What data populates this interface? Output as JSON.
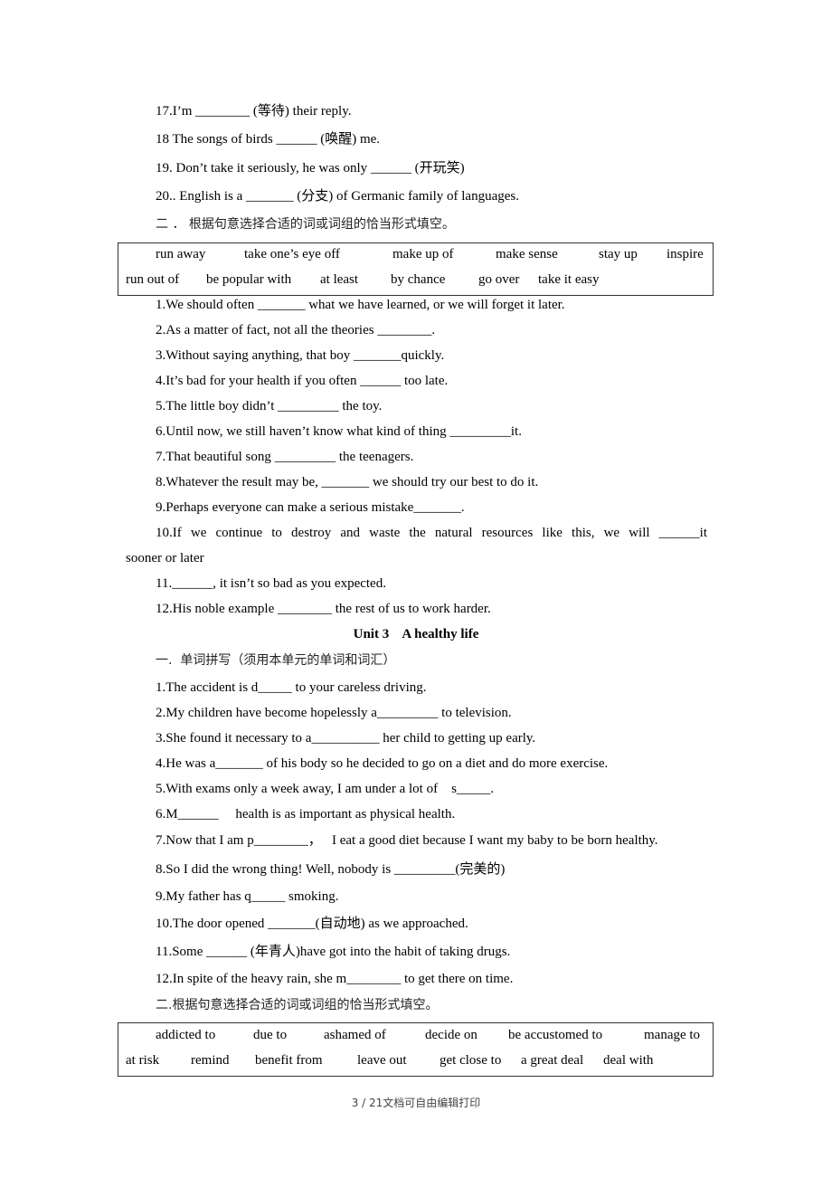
{
  "section_a_items": [
    {
      "number": "17.",
      "text": "I’m ________ (等待) their reply."
    },
    {
      "number": "18",
      "text": " The songs of birds ______ (唤醒) me."
    },
    {
      "number": "19.",
      "text": " Don’t take it seriously, he was only ______ (开玩笑)"
    },
    {
      "number": "20..",
      "text": " English is a _______ (分支) of Germanic family of languages."
    }
  ],
  "section_b": {
    "instruction": "二 ． 根据句意选择合适的词或词组的恰当形式填空。",
    "word_bank": {
      "row1": [
        "run away",
        "take one’s eye off",
        "make up of",
        "make sense",
        "stay up",
        "inspire"
      ],
      "row2": [
        "run out of",
        "be popular with",
        "at least",
        "by chance",
        "go over",
        "take it easy"
      ]
    },
    "items": [
      "1.We should often _______ what we have learned, or we will forget it later.",
      "2.As a matter of fact, not all the theories ________.",
      "3.Without saying anything, that boy _______quickly.",
      "4.It’s bad for your health if you often ______ too late.",
      "5.The little boy didn’t _________ the toy.",
      "6.Until now, we still haven’t know what kind of thing _________it.",
      "7.That beautiful song _________ the teenagers.",
      "8.Whatever the result may be, _______ we should try our best to do it.",
      "9.Perhaps everyone can make a serious mistake_______.",
      "10.If we continue to destroy and waste the natural resources like this, we will ______it",
      "sooner or later",
      "11.______, it isn’t so bad as you expected.",
      "12.His noble example ________ the rest of us to work harder."
    ]
  },
  "unit3": {
    "title": "Unit 3    A healthy life",
    "section_a_instruction": "一.  单词拼写（须用本单元的单词和词汇）",
    "section_a_items": [
      "1.The accident is d_____ to your careless driving.",
      "2.My children have become hopelessly a_________ to television.",
      "3.She found it necessary to a__________ her child to getting up early.",
      "4.He was a_______ of his body so he decided to go on a diet and do more exercise.",
      "5.With exams only a week away, I am under a lot of    s_____.",
      "6.M______     health is as important as physical health.",
      "7.Now that I am p________，   I eat a good diet because I want my baby to be born healthy.",
      "8.So I did the wrong thing! Well, nobody is _________(完美的)",
      "9.My father has q_____ smoking.",
      "10.The door opened _______(自动地) as we approached.",
      "11.Some ______ (年青人)have got into the habit of taking drugs.",
      "12.In spite of the heavy rain, she m________ to get there on time."
    ],
    "section_b_instruction": "二.根据句意选择合适的词或词组的恰当形式填空。",
    "word_bank": {
      "row1": [
        "addicted to",
        "due to",
        "ashamed of",
        "decide on",
        "be accustomed to",
        "manage to"
      ],
      "row2": [
        "at risk",
        "remind",
        "benefit from",
        "leave out",
        "get close to",
        "a great deal",
        "deal with"
      ]
    }
  },
  "footer": {
    "page_indicator": "3 / 21",
    "note": "文档可自由编辑打印"
  }
}
